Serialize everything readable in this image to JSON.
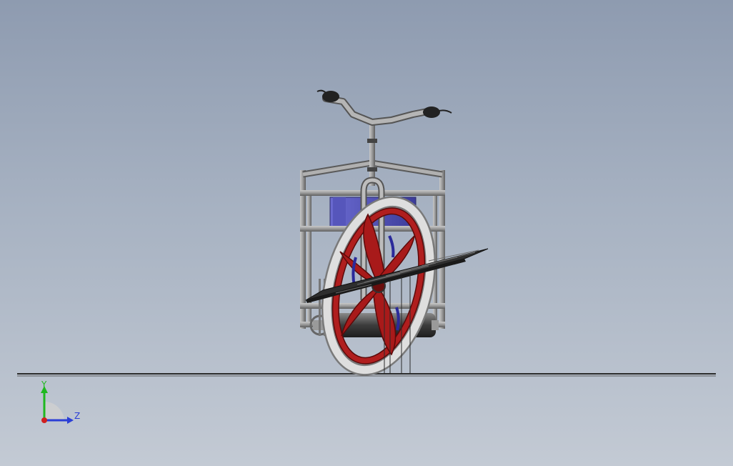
{
  "viewport": {
    "background_top": "#8e9bb0",
    "background_bottom": "#c3cad4"
  },
  "model": {
    "frame_color": "#9a9a9a",
    "wheel_color": "#b01e1e",
    "tire_color": "#d8d8d8",
    "battery_color": "#4a4ab0",
    "plate_color": "#3a3a3a"
  },
  "triad": {
    "y_label": "Y",
    "z_label": "Z",
    "y_color": "#1fb81f",
    "z_color": "#2b3fd6",
    "origin_color": "#d02020"
  }
}
